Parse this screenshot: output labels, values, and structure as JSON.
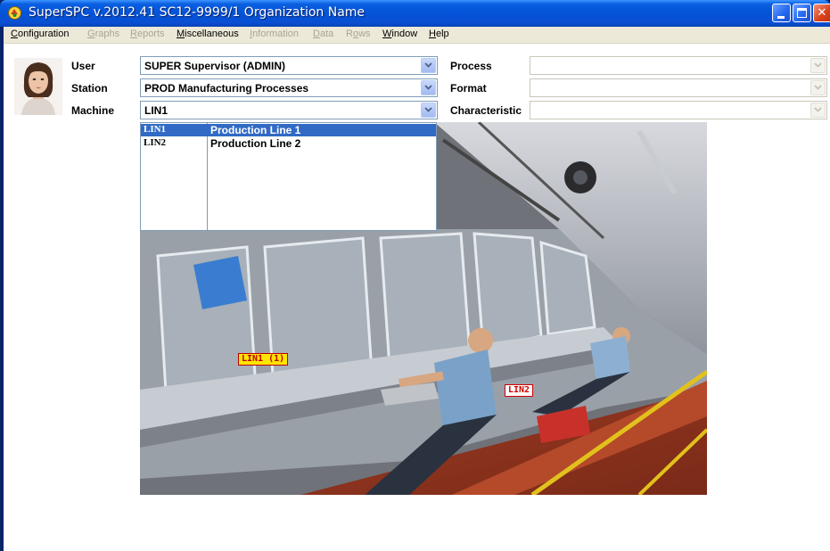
{
  "window": {
    "title": "SuperSPC v.2012.41  SC12-9999/1  Organization Name",
    "minimize_glyph": "",
    "close_glyph": "✕"
  },
  "menu": [
    {
      "label": "Configuration",
      "underline": "C",
      "disabled": false
    },
    {
      "label": "Graphs",
      "underline": "G",
      "disabled": true
    },
    {
      "label": "Reports",
      "underline": "R",
      "disabled": true
    },
    {
      "label": "Miscellaneous",
      "underline": "M",
      "disabled": false
    },
    {
      "label": "Information",
      "underline": "I",
      "disabled": true
    },
    {
      "label": "Data",
      "underline": "D",
      "disabled": true
    },
    {
      "label": "Rows",
      "underline": "o",
      "disabled": true
    },
    {
      "label": "Window",
      "underline": "W",
      "disabled": false
    },
    {
      "label": "Help",
      "underline": "H",
      "disabled": false
    }
  ],
  "form": {
    "user_label": "User",
    "user_value": "SUPER  Supervisor (ADMIN)",
    "station_label": "Station",
    "station_value": "PROD  Manufacturing Processes",
    "machine_label": "Machine",
    "machine_value": "LIN1",
    "process_label": "Process",
    "process_value": "",
    "format_label": "Format",
    "format_value": "",
    "characteristic_label": "Characteristic",
    "characteristic_value": ""
  },
  "machine_dropdown": [
    {
      "code": "LIN1",
      "name": "Production Line 1",
      "selected": true
    },
    {
      "code": "LIN2",
      "name": "Production Line 2",
      "selected": false
    }
  ],
  "photo_tags": {
    "lin1": "LIN1 (1)",
    "lin2": "LIN2"
  },
  "colors": {
    "selection": "#316ac5",
    "titlebar": "#0453d8",
    "lin1_tag_bg": "#ffe600",
    "lin_tag_text": "#c00000"
  }
}
